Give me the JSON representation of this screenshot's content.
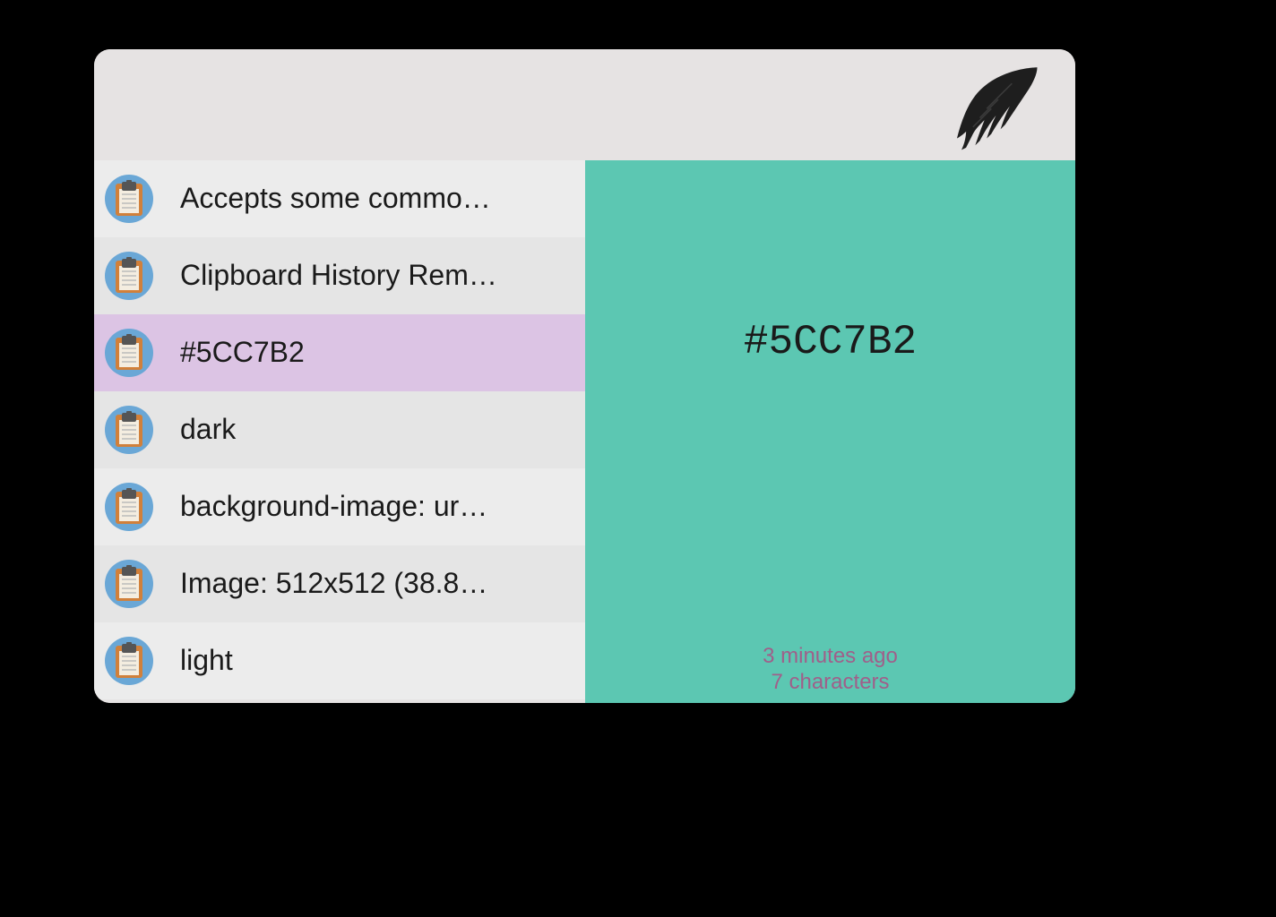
{
  "items": [
    {
      "label": "Accepts some commo…",
      "selected": false
    },
    {
      "label": "Clipboard History Rem…",
      "selected": false
    },
    {
      "label": "#5CC7B2",
      "selected": true
    },
    {
      "label": "dark",
      "selected": false
    },
    {
      "label": "background-image: ur…",
      "selected": false
    },
    {
      "label": "Image: 512x512 (38.8…",
      "selected": false
    },
    {
      "label": "light",
      "selected": false
    }
  ],
  "preview": {
    "text": "#5CC7B2",
    "background": "#5CC7B2",
    "timestamp": "3 minutes ago",
    "charcount": "7 characters"
  }
}
